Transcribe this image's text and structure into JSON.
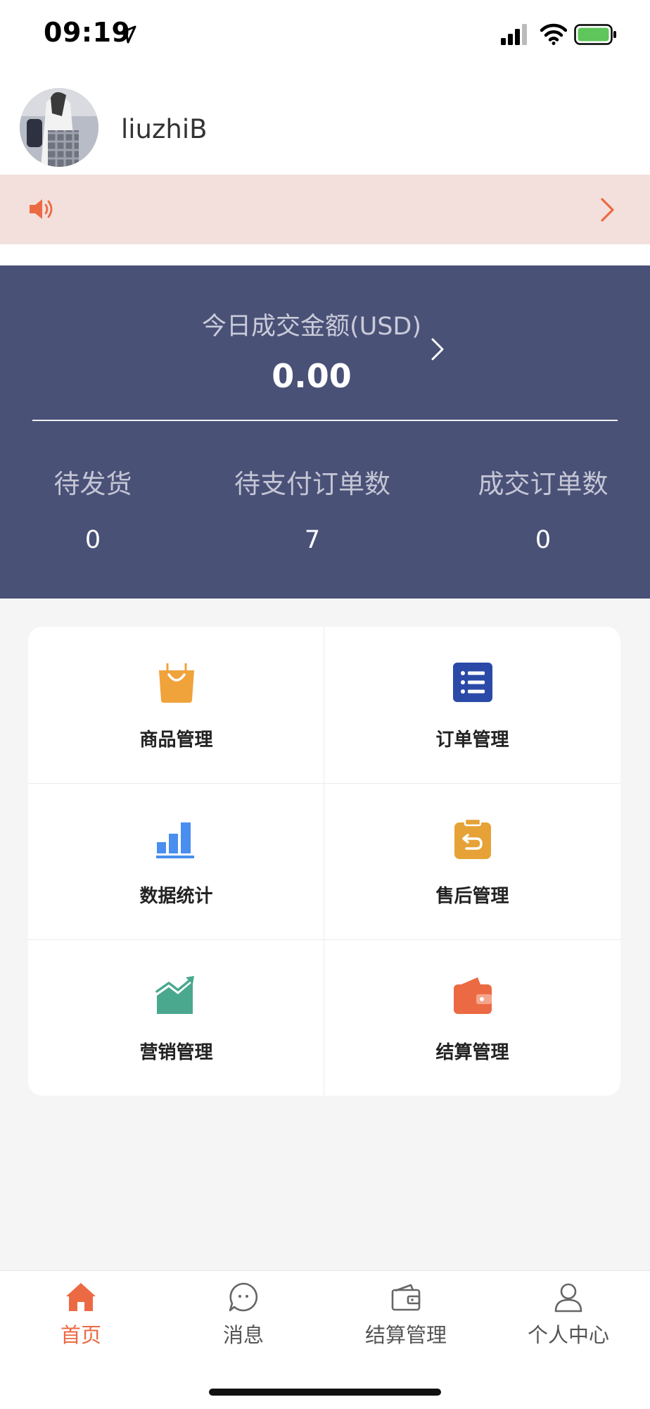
{
  "status_bar": {
    "time": "09:19"
  },
  "user": {
    "name": "liuzhiB"
  },
  "stats": {
    "today_label": "今日成交金额(USD)",
    "today_value": "0.00",
    "items": [
      {
        "label": "待发货",
        "value": "0"
      },
      {
        "label": "待支付订单数",
        "value": "7"
      },
      {
        "label": "成交订单数",
        "value": "0"
      }
    ]
  },
  "menu": [
    {
      "label": "商品管理",
      "icon": "shopping-bag-icon",
      "color": "#f0a23b"
    },
    {
      "label": "订单管理",
      "icon": "order-list-icon",
      "color": "#2b4aa8"
    },
    {
      "label": "数据统计",
      "icon": "bar-chart-icon",
      "color": "#4a8ef0"
    },
    {
      "label": "售后管理",
      "icon": "return-clipboard-icon",
      "color": "#e6a236"
    },
    {
      "label": "营销管理",
      "icon": "trend-chart-icon",
      "color": "#4aa88f"
    },
    {
      "label": "结算管理",
      "icon": "wallet-icon",
      "color": "#ec6a43"
    }
  ],
  "tabs": [
    {
      "label": "首页",
      "icon": "home-icon",
      "active": true
    },
    {
      "label": "消息",
      "icon": "message-icon",
      "active": false
    },
    {
      "label": "结算管理",
      "icon": "wallet-icon",
      "active": false
    },
    {
      "label": "个人中心",
      "icon": "user-icon",
      "active": false
    }
  ],
  "colors": {
    "accent": "#ec6a43",
    "stats_bg": "#4a5177",
    "notice_bg": "#f3e0dc"
  }
}
